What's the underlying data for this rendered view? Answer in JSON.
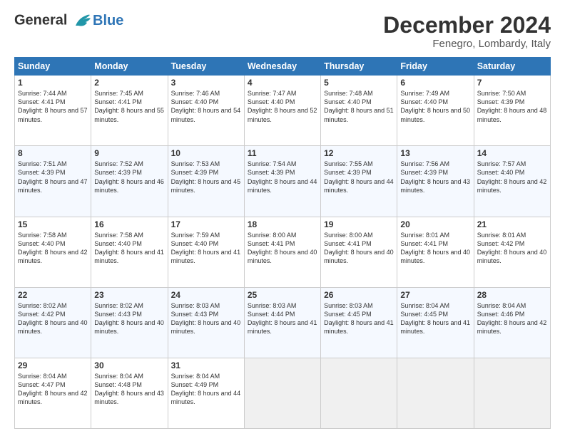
{
  "header": {
    "logo_line1": "General",
    "logo_line2": "Blue",
    "month": "December 2024",
    "location": "Fenegro, Lombardy, Italy"
  },
  "days_of_week": [
    "Sunday",
    "Monday",
    "Tuesday",
    "Wednesday",
    "Thursday",
    "Friday",
    "Saturday"
  ],
  "weeks": [
    [
      {
        "day": "1",
        "sunrise": "Sunrise: 7:44 AM",
        "sunset": "Sunset: 4:41 PM",
        "daylight": "Daylight: 8 hours and 57 minutes."
      },
      {
        "day": "2",
        "sunrise": "Sunrise: 7:45 AM",
        "sunset": "Sunset: 4:41 PM",
        "daylight": "Daylight: 8 hours and 55 minutes."
      },
      {
        "day": "3",
        "sunrise": "Sunrise: 7:46 AM",
        "sunset": "Sunset: 4:40 PM",
        "daylight": "Daylight: 8 hours and 54 minutes."
      },
      {
        "day": "4",
        "sunrise": "Sunrise: 7:47 AM",
        "sunset": "Sunset: 4:40 PM",
        "daylight": "Daylight: 8 hours and 52 minutes."
      },
      {
        "day": "5",
        "sunrise": "Sunrise: 7:48 AM",
        "sunset": "Sunset: 4:40 PM",
        "daylight": "Daylight: 8 hours and 51 minutes."
      },
      {
        "day": "6",
        "sunrise": "Sunrise: 7:49 AM",
        "sunset": "Sunset: 4:40 PM",
        "daylight": "Daylight: 8 hours and 50 minutes."
      },
      {
        "day": "7",
        "sunrise": "Sunrise: 7:50 AM",
        "sunset": "Sunset: 4:39 PM",
        "daylight": "Daylight: 8 hours and 48 minutes."
      }
    ],
    [
      {
        "day": "8",
        "sunrise": "Sunrise: 7:51 AM",
        "sunset": "Sunset: 4:39 PM",
        "daylight": "Daylight: 8 hours and 47 minutes."
      },
      {
        "day": "9",
        "sunrise": "Sunrise: 7:52 AM",
        "sunset": "Sunset: 4:39 PM",
        "daylight": "Daylight: 8 hours and 46 minutes."
      },
      {
        "day": "10",
        "sunrise": "Sunrise: 7:53 AM",
        "sunset": "Sunset: 4:39 PM",
        "daylight": "Daylight: 8 hours and 45 minutes."
      },
      {
        "day": "11",
        "sunrise": "Sunrise: 7:54 AM",
        "sunset": "Sunset: 4:39 PM",
        "daylight": "Daylight: 8 hours and 44 minutes."
      },
      {
        "day": "12",
        "sunrise": "Sunrise: 7:55 AM",
        "sunset": "Sunset: 4:39 PM",
        "daylight": "Daylight: 8 hours and 44 minutes."
      },
      {
        "day": "13",
        "sunrise": "Sunrise: 7:56 AM",
        "sunset": "Sunset: 4:39 PM",
        "daylight": "Daylight: 8 hours and 43 minutes."
      },
      {
        "day": "14",
        "sunrise": "Sunrise: 7:57 AM",
        "sunset": "Sunset: 4:40 PM",
        "daylight": "Daylight: 8 hours and 42 minutes."
      }
    ],
    [
      {
        "day": "15",
        "sunrise": "Sunrise: 7:58 AM",
        "sunset": "Sunset: 4:40 PM",
        "daylight": "Daylight: 8 hours and 42 minutes."
      },
      {
        "day": "16",
        "sunrise": "Sunrise: 7:58 AM",
        "sunset": "Sunset: 4:40 PM",
        "daylight": "Daylight: 8 hours and 41 minutes."
      },
      {
        "day": "17",
        "sunrise": "Sunrise: 7:59 AM",
        "sunset": "Sunset: 4:40 PM",
        "daylight": "Daylight: 8 hours and 41 minutes."
      },
      {
        "day": "18",
        "sunrise": "Sunrise: 8:00 AM",
        "sunset": "Sunset: 4:41 PM",
        "daylight": "Daylight: 8 hours and 40 minutes."
      },
      {
        "day": "19",
        "sunrise": "Sunrise: 8:00 AM",
        "sunset": "Sunset: 4:41 PM",
        "daylight": "Daylight: 8 hours and 40 minutes."
      },
      {
        "day": "20",
        "sunrise": "Sunrise: 8:01 AM",
        "sunset": "Sunset: 4:41 PM",
        "daylight": "Daylight: 8 hours and 40 minutes."
      },
      {
        "day": "21",
        "sunrise": "Sunrise: 8:01 AM",
        "sunset": "Sunset: 4:42 PM",
        "daylight": "Daylight: 8 hours and 40 minutes."
      }
    ],
    [
      {
        "day": "22",
        "sunrise": "Sunrise: 8:02 AM",
        "sunset": "Sunset: 4:42 PM",
        "daylight": "Daylight: 8 hours and 40 minutes."
      },
      {
        "day": "23",
        "sunrise": "Sunrise: 8:02 AM",
        "sunset": "Sunset: 4:43 PM",
        "daylight": "Daylight: 8 hours and 40 minutes."
      },
      {
        "day": "24",
        "sunrise": "Sunrise: 8:03 AM",
        "sunset": "Sunset: 4:43 PM",
        "daylight": "Daylight: 8 hours and 40 minutes."
      },
      {
        "day": "25",
        "sunrise": "Sunrise: 8:03 AM",
        "sunset": "Sunset: 4:44 PM",
        "daylight": "Daylight: 8 hours and 41 minutes."
      },
      {
        "day": "26",
        "sunrise": "Sunrise: 8:03 AM",
        "sunset": "Sunset: 4:45 PM",
        "daylight": "Daylight: 8 hours and 41 minutes."
      },
      {
        "day": "27",
        "sunrise": "Sunrise: 8:04 AM",
        "sunset": "Sunset: 4:45 PM",
        "daylight": "Daylight: 8 hours and 41 minutes."
      },
      {
        "day": "28",
        "sunrise": "Sunrise: 8:04 AM",
        "sunset": "Sunset: 4:46 PM",
        "daylight": "Daylight: 8 hours and 42 minutes."
      }
    ],
    [
      {
        "day": "29",
        "sunrise": "Sunrise: 8:04 AM",
        "sunset": "Sunset: 4:47 PM",
        "daylight": "Daylight: 8 hours and 42 minutes."
      },
      {
        "day": "30",
        "sunrise": "Sunrise: 8:04 AM",
        "sunset": "Sunset: 4:48 PM",
        "daylight": "Daylight: 8 hours and 43 minutes."
      },
      {
        "day": "31",
        "sunrise": "Sunrise: 8:04 AM",
        "sunset": "Sunset: 4:49 PM",
        "daylight": "Daylight: 8 hours and 44 minutes."
      },
      null,
      null,
      null,
      null
    ]
  ]
}
